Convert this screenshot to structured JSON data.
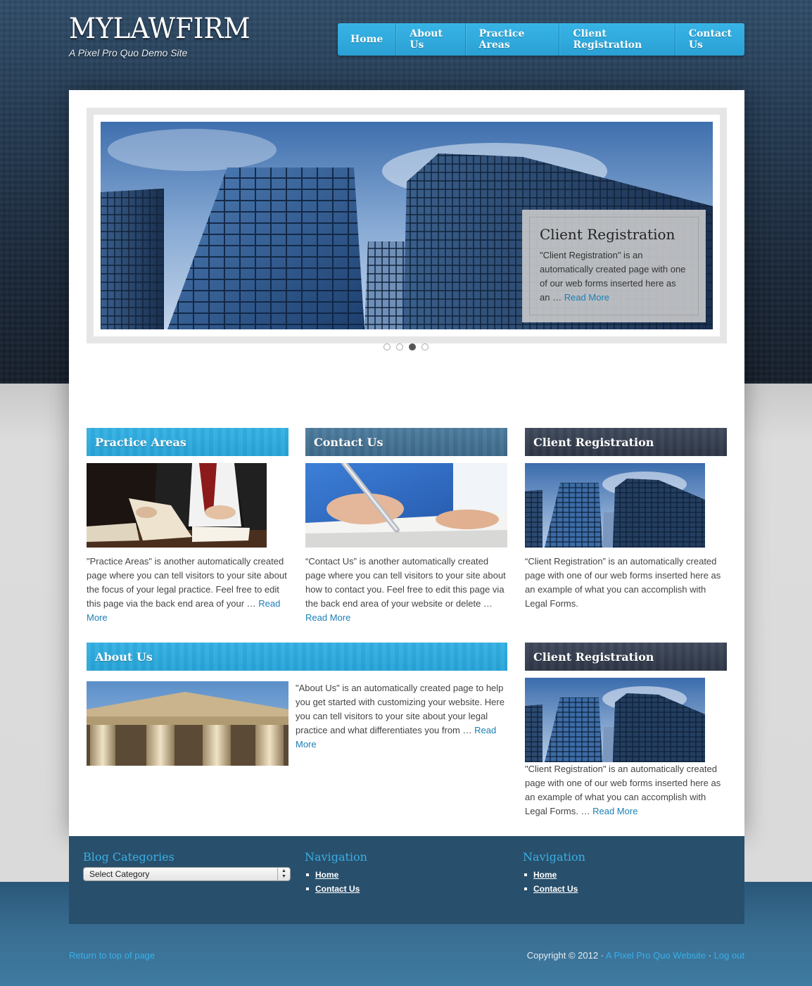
{
  "site": {
    "title": "MYLAWFIRM",
    "tagline": "A Pixel Pro Quo Demo Site"
  },
  "nav": {
    "items": [
      {
        "label": "Home"
      },
      {
        "label": "About Us"
      },
      {
        "label": "Practice Areas"
      },
      {
        "label": "Client Registration"
      },
      {
        "label": "Contact Us"
      }
    ]
  },
  "slider": {
    "caption_title": "Client Registration",
    "caption_text": "\"Client Registration\" is an automatically created page with one of our web forms inserted here as an …",
    "read_more": "Read More",
    "active_slide": 3,
    "slide_count": 4
  },
  "widgets": {
    "practice": {
      "title": "Practice Areas",
      "text": "\"Practice Areas\" is another automatically created page where you can tell visitors to your site about the focus of your legal practice. Feel free to edit this page via the back end area of your …",
      "read_more": "Read More"
    },
    "contact": {
      "title": "Contact Us",
      "text": "“Contact Us” is another automatically created page where you can tell visitors to your site about how to contact you. Feel free to edit this page via the back end area of your website or delete …",
      "read_more": "Read More"
    },
    "client1": {
      "title": "Client Registration",
      "text": "“Client Registration” is an automatically created page with one of our web forms inserted here as an example of what you can accomplish with Legal Forms."
    },
    "about": {
      "title": "About Us",
      "text": "\"About Us\" is an automatically created page to help you get started with customizing your website. Here you can tell visitors to your site about your legal practice and what differentiates you from …",
      "read_more": "Read More"
    },
    "client2": {
      "title": "Client Registration",
      "text": "\"Client Registration\" is an automatically created page with one of our web forms inserted here as an example of what you can accomplish with Legal Forms. …",
      "read_more": "Read More"
    }
  },
  "footer_widgets": {
    "blog": {
      "title": "Blog Categories",
      "select_value": "Select Category"
    },
    "nav1": {
      "title": "Navigation",
      "items": [
        "Home",
        "Contact Us"
      ]
    },
    "nav2": {
      "title": "Navigation",
      "items": [
        "Home",
        "Contact Us"
      ]
    }
  },
  "footer": {
    "return_top": "Return to top of page",
    "copyright": "Copyright © 2012 ·",
    "site_link": "A Pixel Pro Quo Website",
    "separator": "·",
    "logout": "Log out"
  },
  "colors": {
    "accent_blue": "#2aa6dc",
    "slate_blue": "#3f6a8a",
    "dark_slate": "#333b4c",
    "link": "#1b7fb5",
    "footer_bg": "#284f6b"
  }
}
